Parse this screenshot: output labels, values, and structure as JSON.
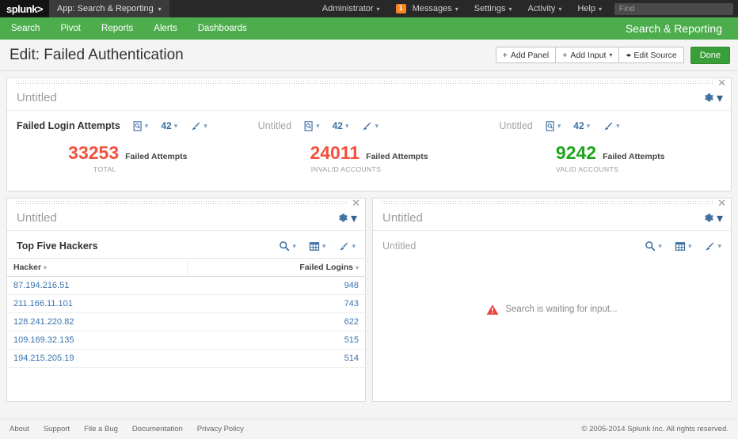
{
  "topbar": {
    "logo": "splunk",
    "logo_caret": ">",
    "app_label": "App: Search & Reporting",
    "items": [
      {
        "label": "Administrator",
        "icon": "chevron-down-icon",
        "badge": null
      },
      {
        "label": "Messages",
        "icon": "chevron-down-icon",
        "badge": "1"
      },
      {
        "label": "Settings",
        "icon": "chevron-down-icon",
        "badge": null
      },
      {
        "label": "Activity",
        "icon": "chevron-down-icon",
        "badge": null
      },
      {
        "label": "Help",
        "icon": "chevron-down-icon",
        "badge": null
      }
    ],
    "find_placeholder": "Find"
  },
  "appnav": {
    "items": [
      "Search",
      "Pivot",
      "Reports",
      "Alerts",
      "Dashboards"
    ],
    "title": "Search & Reporting",
    "bg_color": "#4dad4d"
  },
  "pagehead": {
    "title": "Edit: Failed Authentication",
    "buttons": [
      {
        "label": "Add Panel",
        "prefix": "+",
        "caret": false
      },
      {
        "label": "Add Input",
        "prefix": "+",
        "caret": true
      },
      {
        "label": "Edit Source",
        "prefix": "◂▸",
        "caret": false
      }
    ],
    "done_label": "Done"
  },
  "panels": [
    {
      "id": "panel-single-values",
      "title": "Untitled",
      "close_icon": "close-icon",
      "gear_icon": "gear-icon",
      "cells": [
        {
          "viz_title": "Failed Login Attempts",
          "tools": [
            {
              "icon": "search-doc-icon",
              "label": null
            },
            {
              "icon": "number-format-icon",
              "label": "42"
            },
            {
              "icon": "paintbrush-icon",
              "label": null
            }
          ]
        },
        {
          "viz_title": "Untitled",
          "muted": true,
          "tools": [
            {
              "icon": "search-doc-icon",
              "label": null
            },
            {
              "icon": "number-format-icon",
              "label": "42"
            },
            {
              "icon": "paintbrush-icon",
              "label": null
            }
          ]
        },
        {
          "viz_title": "Untitled",
          "muted": true,
          "tools": [
            {
              "icon": "search-doc-icon",
              "label": null
            },
            {
              "icon": "number-format-icon",
              "label": "42"
            },
            {
              "icon": "paintbrush-icon",
              "label": null
            }
          ]
        }
      ],
      "single_values": [
        {
          "value": "33253",
          "label": "Failed Attempts",
          "sublabel": "TOTAL",
          "color": "#f4503c"
        },
        {
          "value": "24011",
          "label": "Failed Attempts",
          "sublabel": "INVALID ACCOUNTS",
          "color": "#f4503c"
        },
        {
          "value": "9242",
          "label": "Failed Attempts",
          "sublabel": "VALID ACCOUNTS",
          "color": "#1ea51e"
        }
      ]
    },
    {
      "id": "panel-top-hackers",
      "title": "Untitled",
      "close_icon": "close-icon",
      "gear_icon": "gear-icon",
      "viz_title": "Top Five Hackers",
      "tools": [
        {
          "icon": "magnifier-icon"
        },
        {
          "icon": "table-grid-icon"
        },
        {
          "icon": "paintbrush-icon"
        }
      ],
      "table": {
        "columns": [
          "Hacker",
          "Failed Logins"
        ],
        "rows": [
          {
            "hacker": "87.194.216.51",
            "failed_logins": "948"
          },
          {
            "hacker": "211.166.11.101",
            "failed_logins": "743"
          },
          {
            "hacker": "128.241.220.82",
            "failed_logins": "622"
          },
          {
            "hacker": "109.169.32.135",
            "failed_logins": "515"
          },
          {
            "hacker": "194.215.205.19",
            "failed_logins": "514"
          }
        ]
      }
    },
    {
      "id": "panel-waiting",
      "title": "Untitled",
      "close_icon": "close-icon",
      "gear_icon": "gear-icon",
      "viz_title": "Untitled",
      "tools": [
        {
          "icon": "magnifier-icon"
        },
        {
          "icon": "table-grid-icon"
        },
        {
          "icon": "paintbrush-icon"
        }
      ],
      "message": "Search is waiting for input...",
      "message_icon": "warning-triangle-icon"
    }
  ],
  "footer": {
    "links": [
      "About",
      "Support",
      "File a Bug",
      "Documentation",
      "Privacy Policy"
    ],
    "copyright": "© 2005-2014 Splunk Inc. All rights reserved."
  }
}
